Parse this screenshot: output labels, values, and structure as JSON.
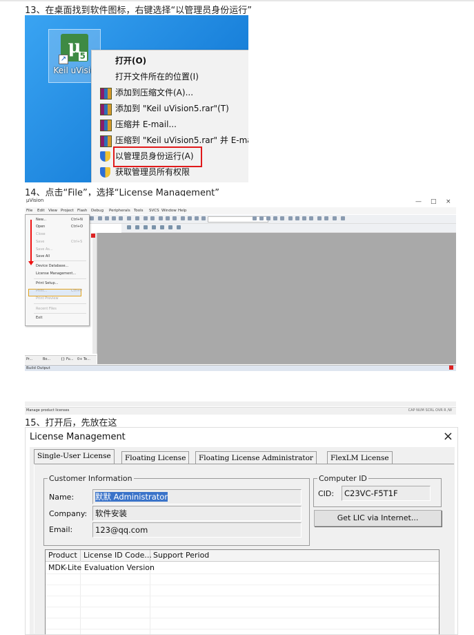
{
  "steps": {
    "step13": "13、在桌面找到软件图标，右键选择“以管理员身份运行”",
    "step14": "14、点击“File”，选择“License Management”",
    "step15": "15、打开后，先放在这"
  },
  "desktop": {
    "icon_label": "Keil uVisio",
    "logo_text": "μ",
    "logo_badge": "5",
    "context_menu": [
      {
        "label": "打开(O)",
        "icon": "none",
        "bold": true
      },
      {
        "label": "打开文件所在的位置(I)",
        "icon": "none"
      },
      {
        "label": "添加到压缩文件(A)...",
        "icon": "winrar-icon"
      },
      {
        "label": "添加到 \"Keil uVision5.rar\"(T)",
        "icon": "winrar-icon"
      },
      {
        "label": "压缩并 E-mail...",
        "icon": "winrar-icon"
      },
      {
        "label": "压缩到 \"Keil uVision5.rar\" 并 E-ma",
        "icon": "winrar-icon"
      },
      {
        "label": "以管理员身份运行(A)",
        "icon": "uac-shield-icon",
        "highlighted": true
      },
      {
        "label": "获取管理员所有权限",
        "icon": "uac-shield-icon"
      }
    ]
  },
  "ide": {
    "title": "μVision",
    "window_buttons": [
      "—",
      "□",
      "×"
    ],
    "menubar": [
      "File",
      "Edit",
      "View",
      "Project",
      "Flash",
      "Debug",
      "Peripherals",
      "Tools",
      "SVCS",
      "Window",
      "Help"
    ],
    "file_menu": [
      {
        "label": "New...",
        "shortcut": "Ctrl+N",
        "disabled": false
      },
      {
        "label": "Open",
        "shortcut": "Ctrl+O",
        "disabled": false
      },
      {
        "label": "Close",
        "shortcut": "",
        "disabled": true
      },
      {
        "label": "Save",
        "shortcut": "Ctrl+S",
        "disabled": true
      },
      {
        "label": "Save As...",
        "shortcut": "",
        "disabled": true
      },
      {
        "label": "Save All",
        "shortcut": "",
        "disabled": false
      },
      {
        "label": "Device Database...",
        "shortcut": "",
        "disabled": false
      },
      {
        "label": "License Management...",
        "shortcut": "",
        "disabled": false,
        "highlighted": true
      },
      {
        "label": "Print Setup...",
        "shortcut": "",
        "disabled": false
      },
      {
        "label": "Print...",
        "shortcut": "Ctrl+P",
        "disabled": true
      },
      {
        "label": "Print Preview",
        "shortcut": "",
        "disabled": true
      },
      {
        "label": "Recent Files",
        "shortcut": "",
        "disabled": true
      },
      {
        "label": "Exit",
        "shortcut": "",
        "disabled": false
      }
    ],
    "project_tabs": [
      "Pr...",
      "Bo...",
      "{} Fu...",
      "0+ Te..."
    ],
    "build_output_label": "Build Output",
    "status_left": "Manage product licenses",
    "status_right": "CAP  NUM  SCRL  OVR  R /W"
  },
  "license_dialog": {
    "title": "License Management",
    "close_glyph": "×",
    "tabs": [
      "Single-User License",
      "Floating License",
      "Floating License Administrator",
      "FlexLM License"
    ],
    "active_tab": 0,
    "customer_info": {
      "legend": "Customer Information",
      "name_label": "Name:",
      "name_value": "默默 Administrator",
      "company_label": "Company:",
      "company_value": "软件安装",
      "email_label": "Email:",
      "email_value": "123@qq.com"
    },
    "computer_id": {
      "legend": "Computer ID",
      "cid_label": "CID:",
      "cid_value": "C23VC-F5T1F"
    },
    "get_lic_button": "Get LIC via Internet...",
    "table": {
      "columns": [
        "Product",
        "License ID Code...",
        "Support Period"
      ],
      "rows": [
        [
          "MDK-Lite",
          "Evaluation Version",
          ""
        ]
      ]
    }
  }
}
